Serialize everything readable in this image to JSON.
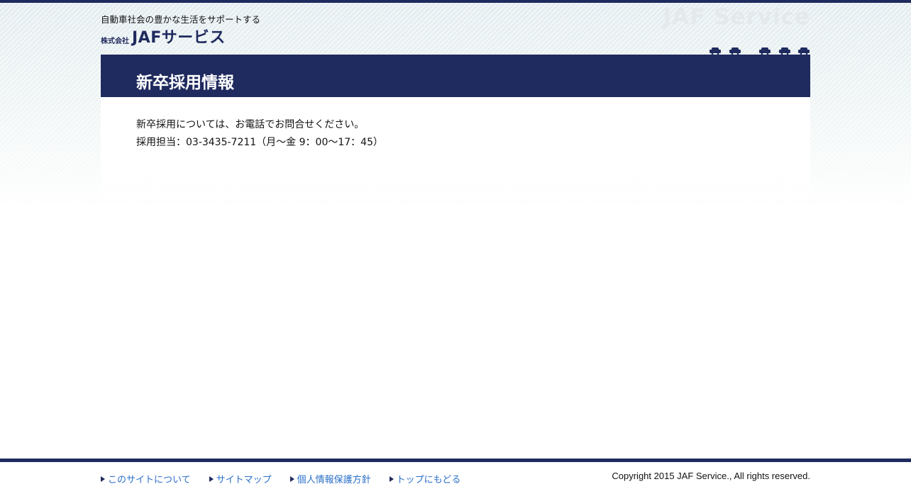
{
  "header": {
    "tagline": "自動車社会の豊かな生活をサポートする",
    "logo_prefix": "株式会社",
    "logo_name": "JAFサービス",
    "watermark": "JAF Service"
  },
  "main": {
    "title": "新卒採用情報",
    "paragraphs": [
      "新卒採用については、お電話でお問合せください。",
      "採用担当：03-3435-7211（月～金 9：00～17：45）"
    ]
  },
  "footer": {
    "links": [
      {
        "label": "このサイトについて"
      },
      {
        "label": "サイトマップ"
      },
      {
        "label": "個人情報保護方針"
      },
      {
        "label": "トップにもどる"
      }
    ],
    "copyright": "Copyright 2015 JAF Service., All rights reserved."
  },
  "colors": {
    "brand_navy": "#1f2a5e",
    "link_blue": "#2a6fc9",
    "watermark_gray": "#e4e9ec"
  },
  "icons": {
    "footer_link_marker": "triangle-right-icon",
    "header_decoration": "car-icon"
  }
}
